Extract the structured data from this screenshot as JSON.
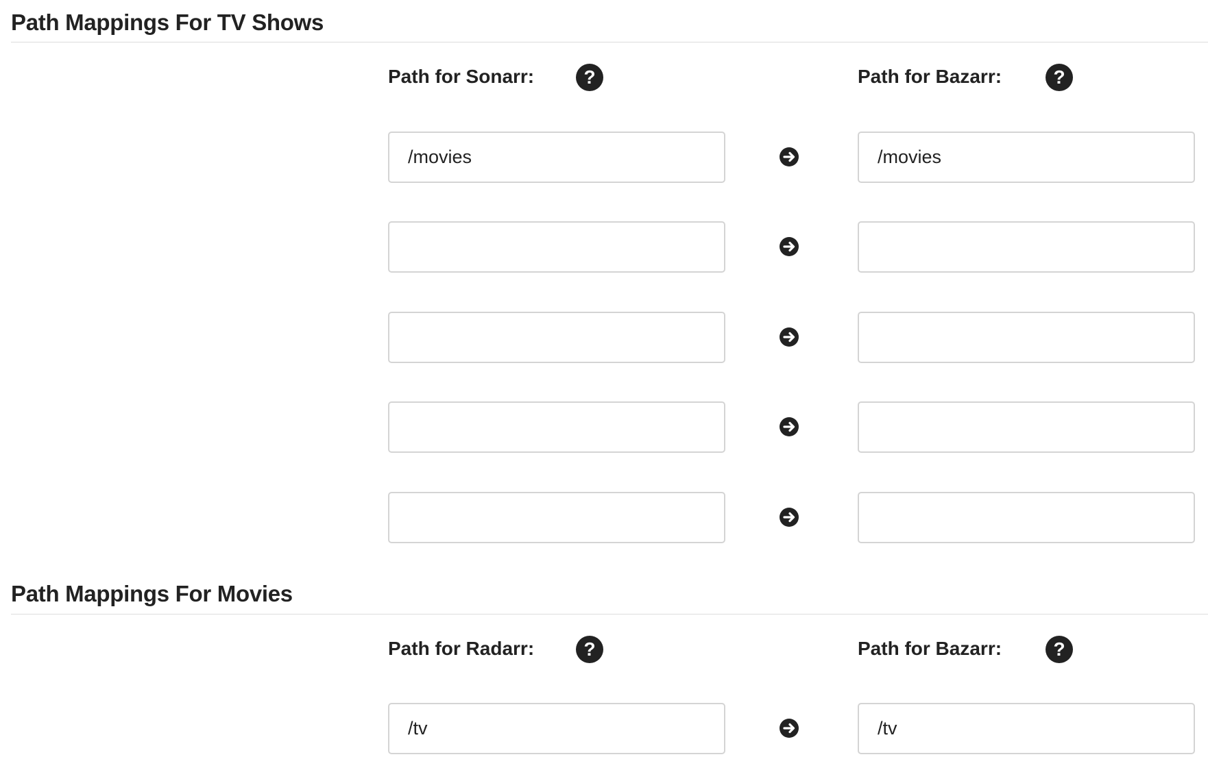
{
  "tv_section": {
    "title": "Path Mappings For TV Shows",
    "left_label": "Path for Sonarr:",
    "right_label": "Path for Bazarr:",
    "rows": [
      {
        "left_value": "/movies",
        "right_value": "/movies"
      },
      {
        "left_value": "",
        "right_value": ""
      },
      {
        "left_value": "",
        "right_value": ""
      },
      {
        "left_value": "",
        "right_value": ""
      },
      {
        "left_value": "",
        "right_value": ""
      }
    ]
  },
  "movies_section": {
    "title": "Path Mappings For Movies",
    "left_label": "Path for Radarr:",
    "right_label": "Path for Bazarr:",
    "rows": [
      {
        "left_value": "/tv",
        "right_value": "/tv"
      }
    ]
  },
  "icons": {
    "help": "question-circle-icon",
    "mapping_arrow": "arrow-circle-right-icon"
  },
  "colors": {
    "text": "#222222",
    "input_border": "#d4d4d4",
    "divider": "#dcdcdc"
  }
}
